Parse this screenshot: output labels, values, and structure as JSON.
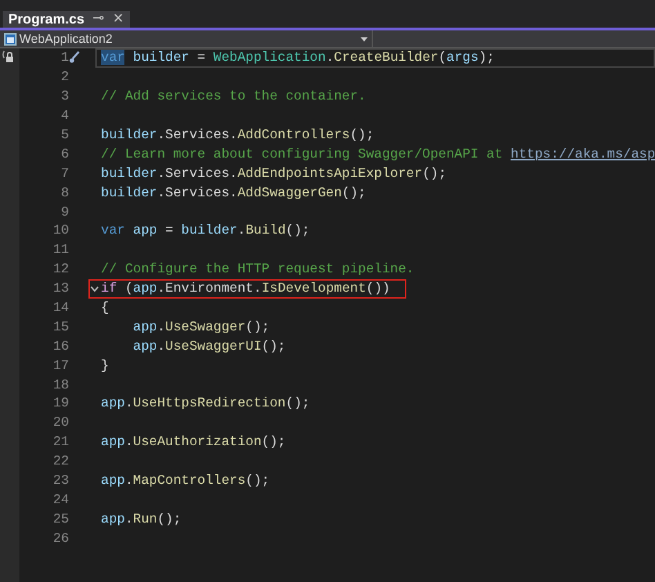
{
  "tab": {
    "title": "Program.cs",
    "pin": "⊸",
    "close": "×"
  },
  "navbar": {
    "project": "WebApplication2"
  },
  "lines": [
    {
      "number": "1",
      "current": true,
      "boxed": false,
      "fold": false,
      "tokens": [
        {
          "kind": "selected-keyword",
          "text": "var"
        },
        {
          "kind": "variable",
          "text": " builder"
        },
        {
          "kind": "plain",
          "text": " = "
        },
        {
          "kind": "type",
          "text": "WebApplication"
        },
        {
          "kind": "plain",
          "text": "."
        },
        {
          "kind": "method",
          "text": "CreateBuilder"
        },
        {
          "kind": "plain",
          "text": "("
        },
        {
          "kind": "variable",
          "text": "args"
        },
        {
          "kind": "plain",
          "text": ");"
        }
      ]
    },
    {
      "number": "2",
      "current": false,
      "boxed": false,
      "fold": false
    },
    {
      "number": "3",
      "current": false,
      "boxed": false,
      "fold": false,
      "tokens": [
        {
          "kind": "comment",
          "text": "// Add services to the container."
        }
      ]
    },
    {
      "number": "4",
      "current": false,
      "boxed": false,
      "fold": false
    },
    {
      "number": "5",
      "current": false,
      "boxed": false,
      "fold": false,
      "tokens": [
        {
          "kind": "variable",
          "text": "builder"
        },
        {
          "kind": "plain",
          "text": ".Services."
        },
        {
          "kind": "method",
          "text": "AddControllers"
        },
        {
          "kind": "plain",
          "text": "();"
        }
      ]
    },
    {
      "number": "6",
      "current": false,
      "boxed": false,
      "fold": false,
      "tokens": [
        {
          "kind": "comment",
          "text": "// Learn more about configuring Swagger/OpenAPI at "
        },
        {
          "kind": "link",
          "text": "https://aka.ms/asp"
        }
      ]
    },
    {
      "number": "7",
      "current": false,
      "boxed": false,
      "fold": false,
      "tokens": [
        {
          "kind": "variable",
          "text": "builder"
        },
        {
          "kind": "plain",
          "text": ".Services."
        },
        {
          "kind": "method",
          "text": "AddEndpointsApiExplorer"
        },
        {
          "kind": "plain",
          "text": "();"
        }
      ]
    },
    {
      "number": "8",
      "current": false,
      "boxed": false,
      "fold": false,
      "tokens": [
        {
          "kind": "variable",
          "text": "builder"
        },
        {
          "kind": "plain",
          "text": ".Services."
        },
        {
          "kind": "method",
          "text": "AddSwaggerGen"
        },
        {
          "kind": "plain",
          "text": "();"
        }
      ]
    },
    {
      "number": "9",
      "current": false,
      "boxed": false,
      "fold": false
    },
    {
      "number": "10",
      "current": false,
      "boxed": false,
      "fold": false,
      "tokens": [
        {
          "kind": "keyword",
          "text": "var"
        },
        {
          "kind": "variable",
          "text": " app"
        },
        {
          "kind": "plain",
          "text": " = "
        },
        {
          "kind": "variable",
          "text": "builder"
        },
        {
          "kind": "plain",
          "text": "."
        },
        {
          "kind": "method",
          "text": "Build"
        },
        {
          "kind": "plain",
          "text": "();"
        }
      ]
    },
    {
      "number": "11",
      "current": false,
      "boxed": false,
      "fold": false
    },
    {
      "number": "12",
      "current": false,
      "boxed": false,
      "fold": false,
      "tokens": [
        {
          "kind": "comment",
          "text": "// Configure the HTTP request pipeline."
        }
      ]
    },
    {
      "number": "13",
      "current": false,
      "boxed": true,
      "fold": true,
      "tokens": [
        {
          "kind": "control",
          "text": "if"
        },
        {
          "kind": "plain",
          "text": " ("
        },
        {
          "kind": "variable",
          "text": "app"
        },
        {
          "kind": "plain",
          "text": ".Environment."
        },
        {
          "kind": "method",
          "text": "IsDevelopment"
        },
        {
          "kind": "plain",
          "text": "())"
        }
      ]
    },
    {
      "number": "14",
      "current": false,
      "boxed": false,
      "fold": false,
      "tokens": [
        {
          "kind": "plain",
          "text": "{"
        }
      ]
    },
    {
      "number": "15",
      "current": false,
      "boxed": false,
      "fold": false,
      "tokens": [
        {
          "kind": "variable",
          "text": "    app"
        },
        {
          "kind": "plain",
          "text": "."
        },
        {
          "kind": "method",
          "text": "UseSwagger"
        },
        {
          "kind": "plain",
          "text": "();"
        }
      ]
    },
    {
      "number": "16",
      "current": false,
      "boxed": false,
      "fold": false,
      "tokens": [
        {
          "kind": "variable",
          "text": "    app"
        },
        {
          "kind": "plain",
          "text": "."
        },
        {
          "kind": "method",
          "text": "UseSwaggerUI"
        },
        {
          "kind": "plain",
          "text": "();"
        }
      ]
    },
    {
      "number": "17",
      "current": false,
      "boxed": false,
      "fold": false,
      "tokens": [
        {
          "kind": "plain",
          "text": "}"
        }
      ]
    },
    {
      "number": "18",
      "current": false,
      "boxed": false,
      "fold": false
    },
    {
      "number": "19",
      "current": false,
      "boxed": false,
      "fold": false,
      "tokens": [
        {
          "kind": "variable",
          "text": "app"
        },
        {
          "kind": "plain",
          "text": "."
        },
        {
          "kind": "method",
          "text": "UseHttpsRedirection"
        },
        {
          "kind": "plain",
          "text": "();"
        }
      ]
    },
    {
      "number": "20",
      "current": false,
      "boxed": false,
      "fold": false
    },
    {
      "number": "21",
      "current": false,
      "boxed": false,
      "fold": false,
      "tokens": [
        {
          "kind": "variable",
          "text": "app"
        },
        {
          "kind": "plain",
          "text": "."
        },
        {
          "kind": "method",
          "text": "UseAuthorization"
        },
        {
          "kind": "plain",
          "text": "();"
        }
      ]
    },
    {
      "number": "22",
      "current": false,
      "boxed": false,
      "fold": false
    },
    {
      "number": "23",
      "current": false,
      "boxed": false,
      "fold": false,
      "tokens": [
        {
          "kind": "variable",
          "text": "app"
        },
        {
          "kind": "plain",
          "text": "."
        },
        {
          "kind": "method",
          "text": "MapControllers"
        },
        {
          "kind": "plain",
          "text": "();"
        }
      ]
    },
    {
      "number": "24",
      "current": false,
      "boxed": false,
      "fold": false
    },
    {
      "number": "25",
      "current": false,
      "boxed": false,
      "fold": false,
      "tokens": [
        {
          "kind": "variable",
          "text": "app"
        },
        {
          "kind": "plain",
          "text": "."
        },
        {
          "kind": "method",
          "text": "Run"
        },
        {
          "kind": "plain",
          "text": "();"
        }
      ]
    },
    {
      "number": "26",
      "current": false,
      "boxed": false,
      "fold": false
    }
  ]
}
